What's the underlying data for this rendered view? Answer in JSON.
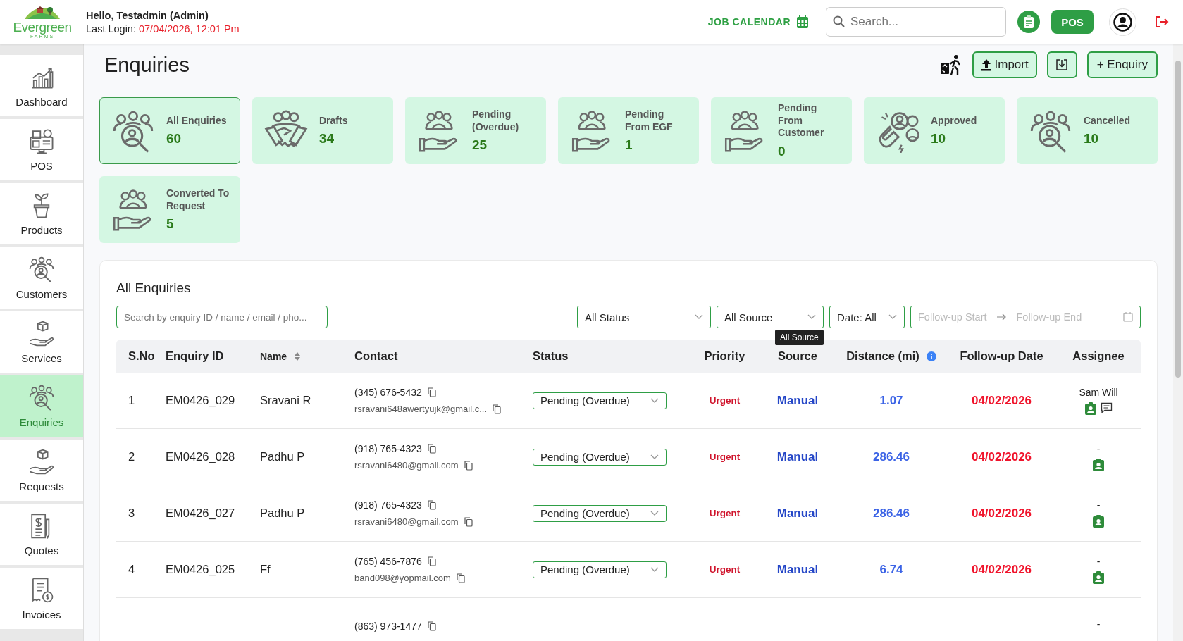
{
  "header": {
    "logo_text": "Evergreen",
    "logo_subtext": "FARMS",
    "greeting": "Hello, Testadmin (Admin)",
    "last_login_label": "Last Login:",
    "last_login_value": "07/04/2026, 12:01 Pm",
    "job_calendar": "JOB CALENDAR",
    "search": {
      "placeholder": "Search..."
    },
    "pos_button": "POS"
  },
  "sidebar": {
    "items": [
      {
        "label": "Dashboard",
        "kind": "chart",
        "selected": false
      },
      {
        "label": "POS",
        "kind": "register",
        "selected": false
      },
      {
        "label": "Products",
        "kind": "plant",
        "selected": false
      },
      {
        "label": "Customers",
        "kind": "people-search",
        "selected": false
      },
      {
        "label": "Services",
        "kind": "box-hand",
        "selected": false
      },
      {
        "label": "Enquiries",
        "kind": "people-search",
        "selected": true
      },
      {
        "label": "Requests",
        "kind": "box-hand",
        "selected": false
      },
      {
        "label": "Quotes",
        "kind": "document",
        "selected": false
      },
      {
        "label": "Invoices",
        "kind": "receipt",
        "selected": false
      }
    ]
  },
  "page": {
    "title": "Enquiries",
    "import_button": "Import",
    "add_button": "+ Enquiry"
  },
  "cards": [
    {
      "label": "All Enquiries",
      "count": "60",
      "kind": "people-search",
      "selected": true
    },
    {
      "label": "Drafts",
      "count": "34",
      "kind": "handshake",
      "selected": false
    },
    {
      "label": "Pending (Overdue)",
      "count": "25",
      "kind": "people-hand",
      "selected": false
    },
    {
      "label": "Pending From EGF",
      "count": "1",
      "kind": "people-hand",
      "selected": false
    },
    {
      "label": "Pending From Customer",
      "count": "0",
      "kind": "people-hand",
      "selected": false
    },
    {
      "label": "Approved",
      "count": "10",
      "kind": "magnet",
      "selected": false
    },
    {
      "label": "Cancelled",
      "count": "10",
      "kind": "people-search",
      "selected": false
    },
    {
      "label": "Converted To Request",
      "count": "5",
      "kind": "people-hand",
      "selected": false
    }
  ],
  "panel": {
    "title": "All Enquiries",
    "search": {
      "placeholder": "Search by enquiry ID / name / email / pho..."
    },
    "filters": [
      {
        "value": "All Status"
      },
      {
        "value": "All Source"
      },
      {
        "value": "Date: All"
      }
    ],
    "tooltip": "All Source",
    "date_range": {
      "start_placeholder": "Follow-up Start",
      "end_placeholder": "Follow-up End"
    },
    "table": {
      "columns": [
        {
          "label": "S.No"
        },
        {
          "label": "Enquiry ID"
        },
        {
          "label": "Name",
          "sortable": true
        },
        {
          "label": "Contact"
        },
        {
          "label": "Status"
        },
        {
          "label": "Priority"
        },
        {
          "label": "Source"
        },
        {
          "label": "Distance (mi)",
          "info": true
        },
        {
          "label": "Follow-up Date"
        },
        {
          "label": "Assignee"
        }
      ],
      "rows": [
        {
          "s_no": "1",
          "enquiry_id": "EM0426_029",
          "name": "Sravani R",
          "phone": "(345) 676-5432",
          "email": "rsravani648awertyujk@gmail.c...",
          "status": "Pending (Overdue)",
          "priority": "Urgent",
          "source": "Manual",
          "distance": "1.07",
          "follow_up_date": "04/02/2026",
          "assignee": "Sam Will",
          "has_chat": true
        },
        {
          "s_no": "2",
          "enquiry_id": "EM0426_028",
          "name": "Padhu P",
          "phone": "(918) 765-4323",
          "email": "rsravani6480@gmail.com",
          "status": "Pending (Overdue)",
          "priority": "Urgent",
          "source": "Manual",
          "distance": "286.46",
          "follow_up_date": "04/02/2026",
          "assignee": "-",
          "has_chat": false
        },
        {
          "s_no": "3",
          "enquiry_id": "EM0426_027",
          "name": "Padhu P",
          "phone": "(918) 765-4323",
          "email": "rsravani6480@gmail.com",
          "status": "Pending (Overdue)",
          "priority": "Urgent",
          "source": "Manual",
          "distance": "286.46",
          "follow_up_date": "04/02/2026",
          "assignee": "-",
          "has_chat": false
        },
        {
          "s_no": "4",
          "enquiry_id": "EM0426_025",
          "name": "Ff",
          "phone": "(765) 456-7876",
          "email": "band098@yopmail.com",
          "status": "Pending (Overdue)",
          "priority": "Urgent",
          "source": "Manual",
          "distance": "6.74",
          "follow_up_date": "04/02/2026",
          "assignee": "-",
          "has_chat": false
        },
        {
          "phone": "(863) 973-1477",
          "assignee": "-"
        }
      ]
    }
  }
}
